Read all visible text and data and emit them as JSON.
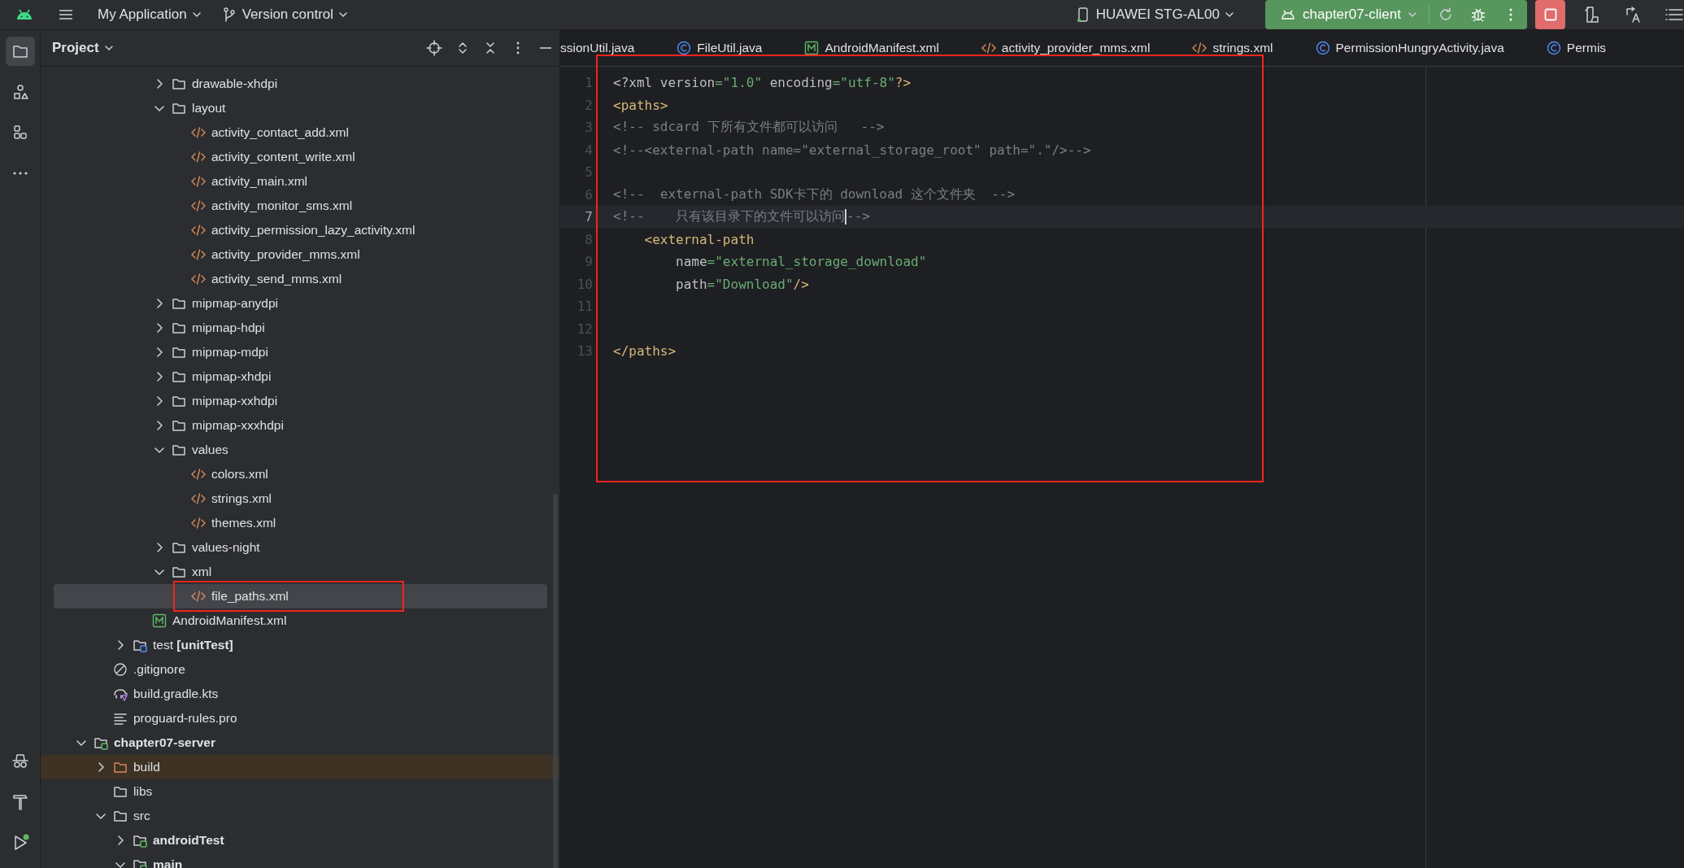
{
  "top_bar": {
    "project": "My Application",
    "vcs": "Version control",
    "device": "HUAWEI STG-AL00",
    "run_config": "chapter07-client"
  },
  "left_toolbar": {
    "items": [
      {
        "kind": "project",
        "selected": true
      },
      {
        "kind": "resources",
        "selected": false
      },
      {
        "kind": "structure",
        "selected": false
      },
      {
        "kind": "more",
        "selected": false
      }
    ],
    "bottom_items": [
      {
        "kind": "spy",
        "selected": false
      },
      {
        "kind": "build",
        "selected": false
      },
      {
        "kind": "run",
        "selected": false
      }
    ]
  },
  "project_panel": {
    "title": "Project",
    "tree": [
      {
        "children": [
          {
            "children": [
              {
                "children": [
                  {
                    "children": [
                      {
                        "label": "drawable-xhdpi",
                        "kind": "folder",
                        "expanded": false,
                        "selected": false
                      },
                      {
                        "label": "layout",
                        "kind": "folder",
                        "expanded": true,
                        "selected": false,
                        "children": [
                          {
                            "label": "activity_contact_add.xml",
                            "kind": "xml",
                            "selected": false
                          },
                          {
                            "label": "activity_content_write.xml",
                            "kind": "xml",
                            "selected": false
                          },
                          {
                            "label": "activity_main.xml",
                            "kind": "xml",
                            "selected": false
                          },
                          {
                            "label": "activity_monitor_sms.xml",
                            "kind": "xml",
                            "selected": false
                          },
                          {
                            "label": "activity_permission_lazy_activity.xml",
                            "kind": "xml",
                            "selected": false
                          },
                          {
                            "label": "activity_provider_mms.xml",
                            "kind": "xml",
                            "selected": false
                          },
                          {
                            "label": "activity_send_mms.xml",
                            "kind": "xml",
                            "selected": false
                          }
                        ]
                      },
                      {
                        "label": "mipmap-anydpi",
                        "kind": "folder",
                        "expanded": false,
                        "selected": false
                      },
                      {
                        "label": "mipmap-hdpi",
                        "kind": "folder",
                        "expanded": false,
                        "selected": false
                      },
                      {
                        "label": "mipmap-mdpi",
                        "kind": "folder",
                        "expanded": false,
                        "selected": false
                      },
                      {
                        "label": "mipmap-xhdpi",
                        "kind": "folder",
                        "expanded": false,
                        "selected": false
                      },
                      {
                        "label": "mipmap-xxhdpi",
                        "kind": "folder",
                        "expanded": false,
                        "selected": false
                      },
                      {
                        "label": "mipmap-xxxhdpi",
                        "kind": "folder",
                        "expanded": false,
                        "selected": false
                      },
                      {
                        "label": "values",
                        "kind": "folder",
                        "expanded": true,
                        "selected": false,
                        "children": [
                          {
                            "label": "colors.xml",
                            "kind": "xml",
                            "selected": false
                          },
                          {
                            "label": "strings.xml",
                            "kind": "xml",
                            "selected": false
                          },
                          {
                            "label": "themes.xml",
                            "kind": "xml",
                            "selected": false
                          }
                        ]
                      },
                      {
                        "label": "values-night",
                        "kind": "folder",
                        "expanded": false,
                        "selected": false
                      },
                      {
                        "label": "xml",
                        "kind": "folder",
                        "expanded": true,
                        "selected": false,
                        "children": [
                          {
                            "label": "file_paths.xml",
                            "kind": "xml",
                            "selected": true,
                            "annotated": true
                          }
                        ]
                      }
                    ]
                  },
                  {
                    "label": "AndroidManifest.xml",
                    "kind": "manifest",
                    "selected": false
                  }
                ]
              },
              {
                "label": "test **[unitTest]**",
                "kind": "test-root",
                "expanded": false,
                "selected": false
              }
            ]
          },
          {
            "label": ".gitignore",
            "kind": "ignore",
            "selected": false
          },
          {
            "label": "build.gradle.kts",
            "kind": "gradle",
            "selected": false
          },
          {
            "label": "proguard-rules.pro",
            "kind": "text",
            "selected": false
          }
        ]
      },
      {
        "label": "chapter07-server",
        "kind": "module",
        "expanded": true,
        "selected": false,
        "children": [
          {
            "label": "build",
            "kind": "excluded",
            "expanded": false,
            "selected": false
          },
          {
            "label": "libs",
            "kind": "folder",
            "selected": false
          },
          {
            "label": "src",
            "kind": "folder",
            "expanded": true,
            "selected": false,
            "children": [
              {
                "label": "androidTest",
                "kind": "source-root",
                "expanded": false,
                "selected": false
              },
              {
                "label": "main",
                "kind": "source-root",
                "expanded": true,
                "selected": false
              }
            ]
          }
        ]
      }
    ]
  },
  "editor": {
    "annotated": true,
    "tabs": [
      {
        "label": "ssionUtil.java",
        "kind": "plain",
        "selected": false
      },
      {
        "label": "FileUtil.java",
        "kind": "java",
        "selected": false
      },
      {
        "label": "AndroidManifest.xml",
        "kind": "manifest",
        "selected": false
      },
      {
        "label": "activity_provider_mms.xml",
        "kind": "xml",
        "selected": false
      },
      {
        "label": "strings.xml",
        "kind": "xml",
        "selected": false
      },
      {
        "label": "PermissionHungryActivity.java",
        "kind": "java",
        "selected": false
      },
      {
        "label": "Permis",
        "kind": "java",
        "selected": false
      }
    ],
    "lines": [
      {
        "number": "1",
        "current": false,
        "tokens": [
          {
            "kind": "text",
            "text": "<?xml version"
          },
          {
            "kind": "string",
            "text": "=\"1.0\""
          },
          {
            "kind": "text",
            "text": " encoding"
          },
          {
            "kind": "string",
            "text": "=\"utf-8\""
          },
          {
            "kind": "tag",
            "text": "?>"
          }
        ]
      },
      {
        "number": "2",
        "current": false,
        "tokens": [
          {
            "kind": "tag",
            "text": "<paths>"
          }
        ]
      },
      {
        "number": "3",
        "current": false,
        "tokens": [
          {
            "kind": "comment",
            "text": "<!-- sdcard 下所有文件都可以访问   -->"
          }
        ]
      },
      {
        "number": "4",
        "current": false,
        "tokens": [
          {
            "kind": "comment",
            "text": "<!--<external-path name=\"external_storage_root\" path=\".\"/>-->"
          }
        ]
      },
      {
        "number": "5",
        "current": false
      },
      {
        "number": "6",
        "current": false,
        "tokens": [
          {
            "kind": "comment",
            "text": "<!--  external-path SDK卡下的 download 这个文件夹  -->"
          }
        ]
      },
      {
        "number": "7",
        "current": true,
        "tokens": [
          {
            "kind": "comment",
            "text": "<!--    只有该目录下的文件可以访问"
          },
          {
            "kind": "caret"
          },
          {
            "kind": "comment",
            "text": "-->"
          }
        ]
      },
      {
        "number": "8",
        "current": false,
        "tokens": [
          {
            "kind": "tag",
            "text": "    <external-path"
          }
        ]
      },
      {
        "number": "9",
        "current": false,
        "tokens": [
          {
            "kind": "text",
            "text": "        name"
          },
          {
            "kind": "string",
            "text": "=\"external_storage_download\""
          }
        ]
      },
      {
        "number": "10",
        "current": false,
        "tokens": [
          {
            "kind": "text",
            "text": "        path"
          },
          {
            "kind": "string",
            "text": "=\"Download\""
          },
          {
            "kind": "tag",
            "text": "/>"
          }
        ]
      },
      {
        "number": "11",
        "current": false
      },
      {
        "number": "12",
        "current": false
      },
      {
        "number": "13",
        "current": false,
        "tokens": [
          {
            "kind": "tag",
            "text": "</paths>"
          }
        ]
      }
    ]
  }
}
